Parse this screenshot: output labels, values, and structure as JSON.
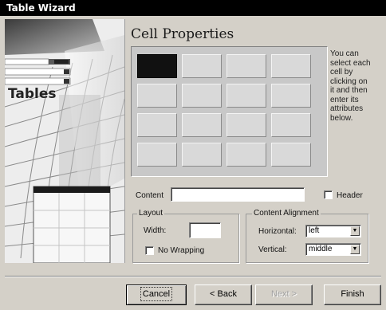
{
  "window": {
    "title": "Table Wizard"
  },
  "illustration": {
    "label": "Tables"
  },
  "page": {
    "heading": "Cell Properties"
  },
  "grid": {
    "rows": 4,
    "columns": 4,
    "selected_cell": [
      0,
      0
    ]
  },
  "hint_lines": [
    "You can",
    "select each",
    "cell by",
    "clicking on",
    "it and then",
    "enter its",
    "attributes",
    "below."
  ],
  "content": {
    "label": "Content",
    "value": ""
  },
  "header": {
    "label": "Header",
    "checked": false
  },
  "layout": {
    "title": "Layout",
    "width_label": "Width:",
    "width_value": "",
    "nowrap_label": "No Wrapping",
    "nowrap_checked": false
  },
  "alignment": {
    "title": "Content Alignment",
    "horizontal_label": "Horizontal:",
    "horizontal_value": "left",
    "vertical_label": "Vertical:",
    "vertical_value": "middle"
  },
  "buttons": {
    "cancel": "Cancel",
    "back": "< Back",
    "next": "Next >",
    "finish": "Finish"
  },
  "colors": {
    "titlebar": "#000000",
    "dialog_bg": "#d4d0c8",
    "selected_cell": "#111111"
  }
}
